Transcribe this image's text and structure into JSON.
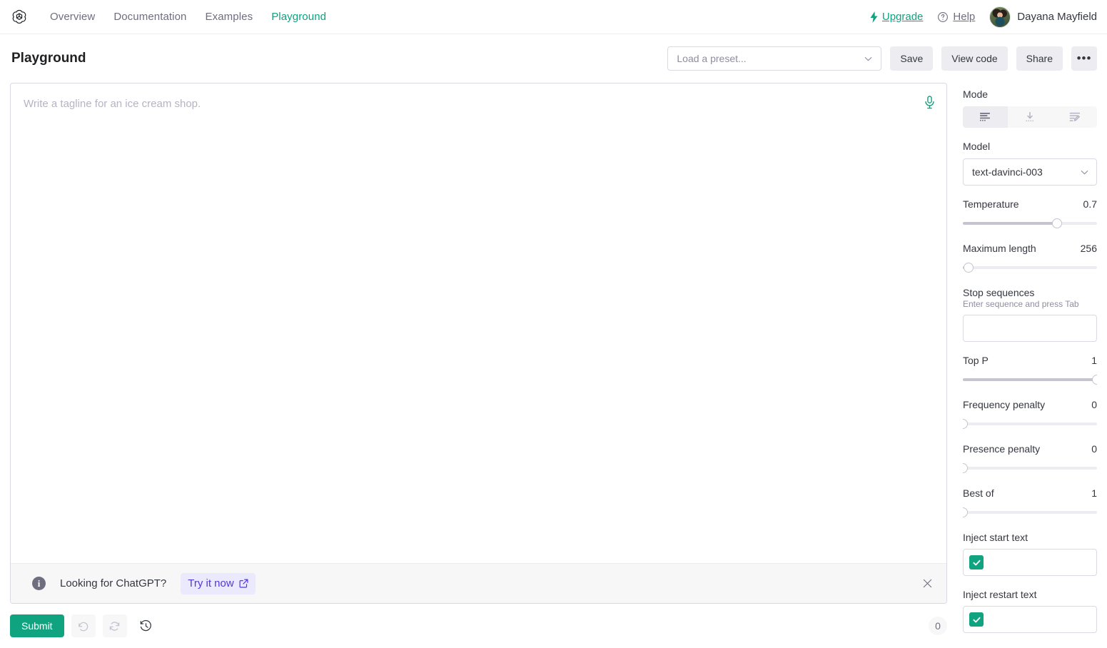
{
  "nav": {
    "logo_icon": "openai-logo-icon",
    "links": [
      {
        "label": "Overview",
        "active": false
      },
      {
        "label": "Documentation",
        "active": false
      },
      {
        "label": "Examples",
        "active": false
      },
      {
        "label": "Playground",
        "active": true
      }
    ],
    "upgrade_label": "Upgrade",
    "help_label": "Help",
    "user_name": "Dayana Mayfield"
  },
  "header": {
    "title": "Playground",
    "preset_placeholder": "Load a preset...",
    "save_label": "Save",
    "view_code_label": "View code",
    "share_label": "Share",
    "more_label": "•••"
  },
  "editor": {
    "placeholder": "Write a tagline for an ice cream shop.",
    "value": "",
    "mic_icon": "microphone-icon"
  },
  "banner": {
    "info_icon": "info-icon",
    "text": "Looking for ChatGPT?",
    "cta_label": "Try it now",
    "external_icon": "external-link-icon",
    "close_icon": "close-icon"
  },
  "actions": {
    "submit_label": "Submit",
    "undo_icon": "undo-icon",
    "regenerate_icon": "regenerate-icon",
    "history_icon": "history-icon",
    "token_count": "0"
  },
  "sidebar": {
    "mode": {
      "label": "Mode",
      "options": [
        {
          "name": "complete",
          "icon": "complete-icon",
          "active": true
        },
        {
          "name": "insert",
          "icon": "insert-icon",
          "active": false
        },
        {
          "name": "edit",
          "icon": "edit-icon",
          "active": false
        }
      ]
    },
    "model": {
      "label": "Model",
      "value": "text-davinci-003"
    },
    "temperature": {
      "label": "Temperature",
      "value": "0.7",
      "percent": 70
    },
    "maximum_length": {
      "label": "Maximum length",
      "value": "256",
      "percent": 4
    },
    "stop_sequences": {
      "label": "Stop sequences",
      "hint": "Enter sequence and press Tab",
      "value": ""
    },
    "top_p": {
      "label": "Top P",
      "value": "1",
      "percent": 100
    },
    "frequency_penalty": {
      "label": "Frequency penalty",
      "value": "0",
      "percent": 0
    },
    "presence_penalty": {
      "label": "Presence penalty",
      "value": "0",
      "percent": 0
    },
    "best_of": {
      "label": "Best of",
      "value": "1",
      "percent": 0
    },
    "inject_start_text": {
      "label": "Inject start text",
      "checked": true,
      "value": ""
    },
    "inject_restart_text": {
      "label": "Inject restart text",
      "checked": true,
      "value": ""
    }
  },
  "colors": {
    "accent": "#10a37f",
    "link": "#5436da",
    "muted": "#6e6e80"
  }
}
